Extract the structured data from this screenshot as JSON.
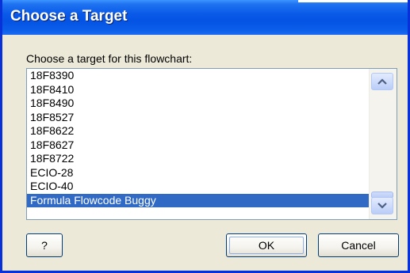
{
  "dialog": {
    "title": "Choose a Target",
    "prompt": "Choose a target for this flowchart:"
  },
  "target_list": {
    "items": [
      {
        "label": "18F8390",
        "selected": false
      },
      {
        "label": "18F8410",
        "selected": false
      },
      {
        "label": "18F8490",
        "selected": false
      },
      {
        "label": "18F8527",
        "selected": false
      },
      {
        "label": "18F8622",
        "selected": false
      },
      {
        "label": "18F8627",
        "selected": false
      },
      {
        "label": "18F8722",
        "selected": false
      },
      {
        "label": "ECIO-28",
        "selected": false
      },
      {
        "label": "ECIO-40",
        "selected": false
      },
      {
        "label": "Formula Flowcode Buggy",
        "selected": true
      }
    ],
    "selected_value": "Formula Flowcode Buggy"
  },
  "buttons": {
    "help_label": "?",
    "ok_label": "OK",
    "cancel_label": "Cancel"
  },
  "icons": {
    "scroll_up": "chevron-up-icon",
    "scroll_down": "chevron-down-icon"
  },
  "colors": {
    "titlebar": "#0553e4",
    "selection": "#316ac5",
    "dialog_face": "#ece9d8",
    "border": "#0831d9"
  }
}
